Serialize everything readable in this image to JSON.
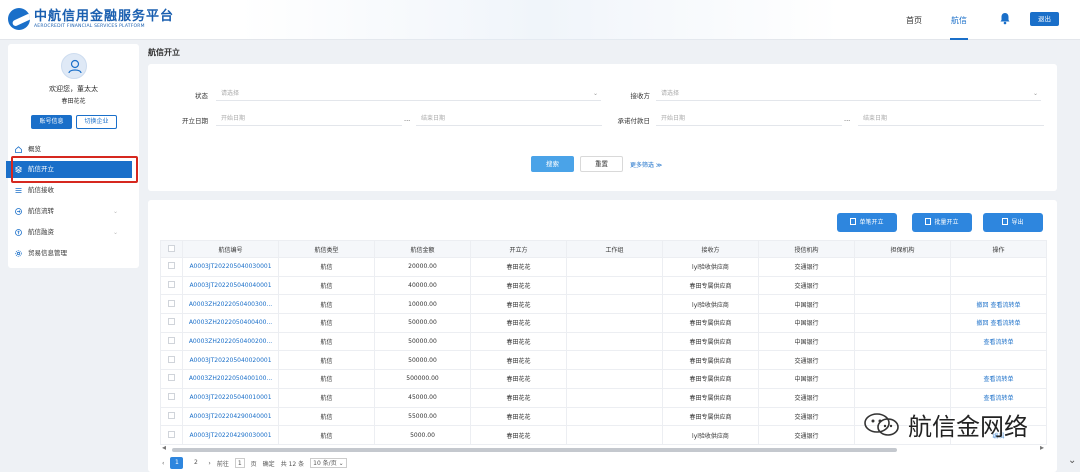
{
  "header": {
    "logo_cn": "中航信用金融服务平台",
    "logo_en": "AEROCREDIT FINANCIAL SERVICES PLATFORM",
    "nav": [
      {
        "label": "首页"
      },
      {
        "label": "航信"
      }
    ],
    "logout": "退出"
  },
  "sidebar": {
    "welcome": "欢迎您，董太太",
    "company": "春田花花",
    "account_btn": "账号信息",
    "switch_btn": "切换企业",
    "items": [
      {
        "label": "概览"
      },
      {
        "label": "航信开立"
      },
      {
        "label": "航信接收"
      },
      {
        "label": "航信流转"
      },
      {
        "label": "航信融资"
      },
      {
        "label": "贸易信息管理"
      }
    ]
  },
  "main": {
    "title": "航信开立",
    "filters": {
      "status_label": "状态",
      "status_placeholder": "请选择",
      "receiver_label": "接收方",
      "receiver_placeholder": "请选择",
      "open_date_label": "开立日期",
      "start_placeholder": "开始日期",
      "range_sep": "...",
      "end_placeholder": "结束日期",
      "due_label": "承诺付款日",
      "due_start_placeholder": "开始日期",
      "due_end_placeholder": "结束日期",
      "search_btn": "搜索",
      "reset_btn": "重置",
      "more_filter": "更多筛选 ≫"
    },
    "actions": {
      "single": "单笔开立",
      "batch": "批量开立",
      "export": "导出"
    },
    "table": {
      "headers": [
        "航信编号",
        "航信类型",
        "航信金额",
        "开立方",
        "工作组",
        "接收方",
        "授信机构",
        "担保机构",
        "操作"
      ],
      "rows": [
        {
          "id": "A0003JT202205040030001",
          "type": "航信",
          "amount": "20000.00",
          "issuer": "春田花花",
          "group": "",
          "receiver": "lyl验收供应商",
          "bank": "交通银行",
          "guarantor": "",
          "ops": ""
        },
        {
          "id": "A0003JT202205040040001",
          "type": "航信",
          "amount": "40000.00",
          "issuer": "春田花花",
          "group": "",
          "receiver": "春田专属供应商",
          "bank": "交通银行",
          "guarantor": "",
          "ops": ""
        },
        {
          "id": "A0003ZH2022050400300...",
          "type": "航信",
          "amount": "10000.00",
          "issuer": "春田花花",
          "group": "",
          "receiver": "lyl验收供应商",
          "bank": "中国银行",
          "guarantor": "",
          "ops": "撤回 查看流转单"
        },
        {
          "id": "A0003ZH2022050400400...",
          "type": "航信",
          "amount": "50000.00",
          "issuer": "春田花花",
          "group": "",
          "receiver": "春田专属供应商",
          "bank": "中国银行",
          "guarantor": "",
          "ops": "撤回 查看流转单"
        },
        {
          "id": "A0003ZH2022050400200...",
          "type": "航信",
          "amount": "50000.00",
          "issuer": "春田花花",
          "group": "",
          "receiver": "春田专属供应商",
          "bank": "中国银行",
          "guarantor": "",
          "ops": "查看流转单"
        },
        {
          "id": "A0003JT202205040020001",
          "type": "航信",
          "amount": "50000.00",
          "issuer": "春田花花",
          "group": "",
          "receiver": "春田专属供应商",
          "bank": "交通银行",
          "guarantor": "",
          "ops": ""
        },
        {
          "id": "A0003ZH2022050400100...",
          "type": "航信",
          "amount": "500000.00",
          "issuer": "春田花花",
          "group": "",
          "receiver": "春田专属供应商",
          "bank": "中国银行",
          "guarantor": "",
          "ops": "查看流转单"
        },
        {
          "id": "A0003JT202205040010001",
          "type": "航信",
          "amount": "45000.00",
          "issuer": "春田花花",
          "group": "",
          "receiver": "春田专属供应商",
          "bank": "交通银行",
          "guarantor": "",
          "ops": "查看流转单"
        },
        {
          "id": "A0003JT202204290040001",
          "type": "航信",
          "amount": "55000.00",
          "issuer": "春田花花",
          "group": "",
          "receiver": "春田专属供应商",
          "bank": "交通银行",
          "guarantor": "",
          "ops": ""
        },
        {
          "id": "A0003JT202204290030001",
          "type": "航信",
          "amount": "5000.00",
          "issuer": "春田花花",
          "group": "",
          "receiver": "lyl验收供应商",
          "bank": "交通银行",
          "guarantor": "",
          "ops": "编辑"
        }
      ]
    },
    "pager": {
      "pages": [
        "1",
        "2"
      ],
      "goto": "前往",
      "goto_page": "1",
      "page_unit": "页",
      "confirm": "确定",
      "total": "共 12 条",
      "page_size": "10 条/页"
    }
  },
  "watermark": {
    "text": "航信金网络"
  },
  "colors": {
    "primary": "#1a6fc9",
    "highlight_box": "#d6281f"
  }
}
